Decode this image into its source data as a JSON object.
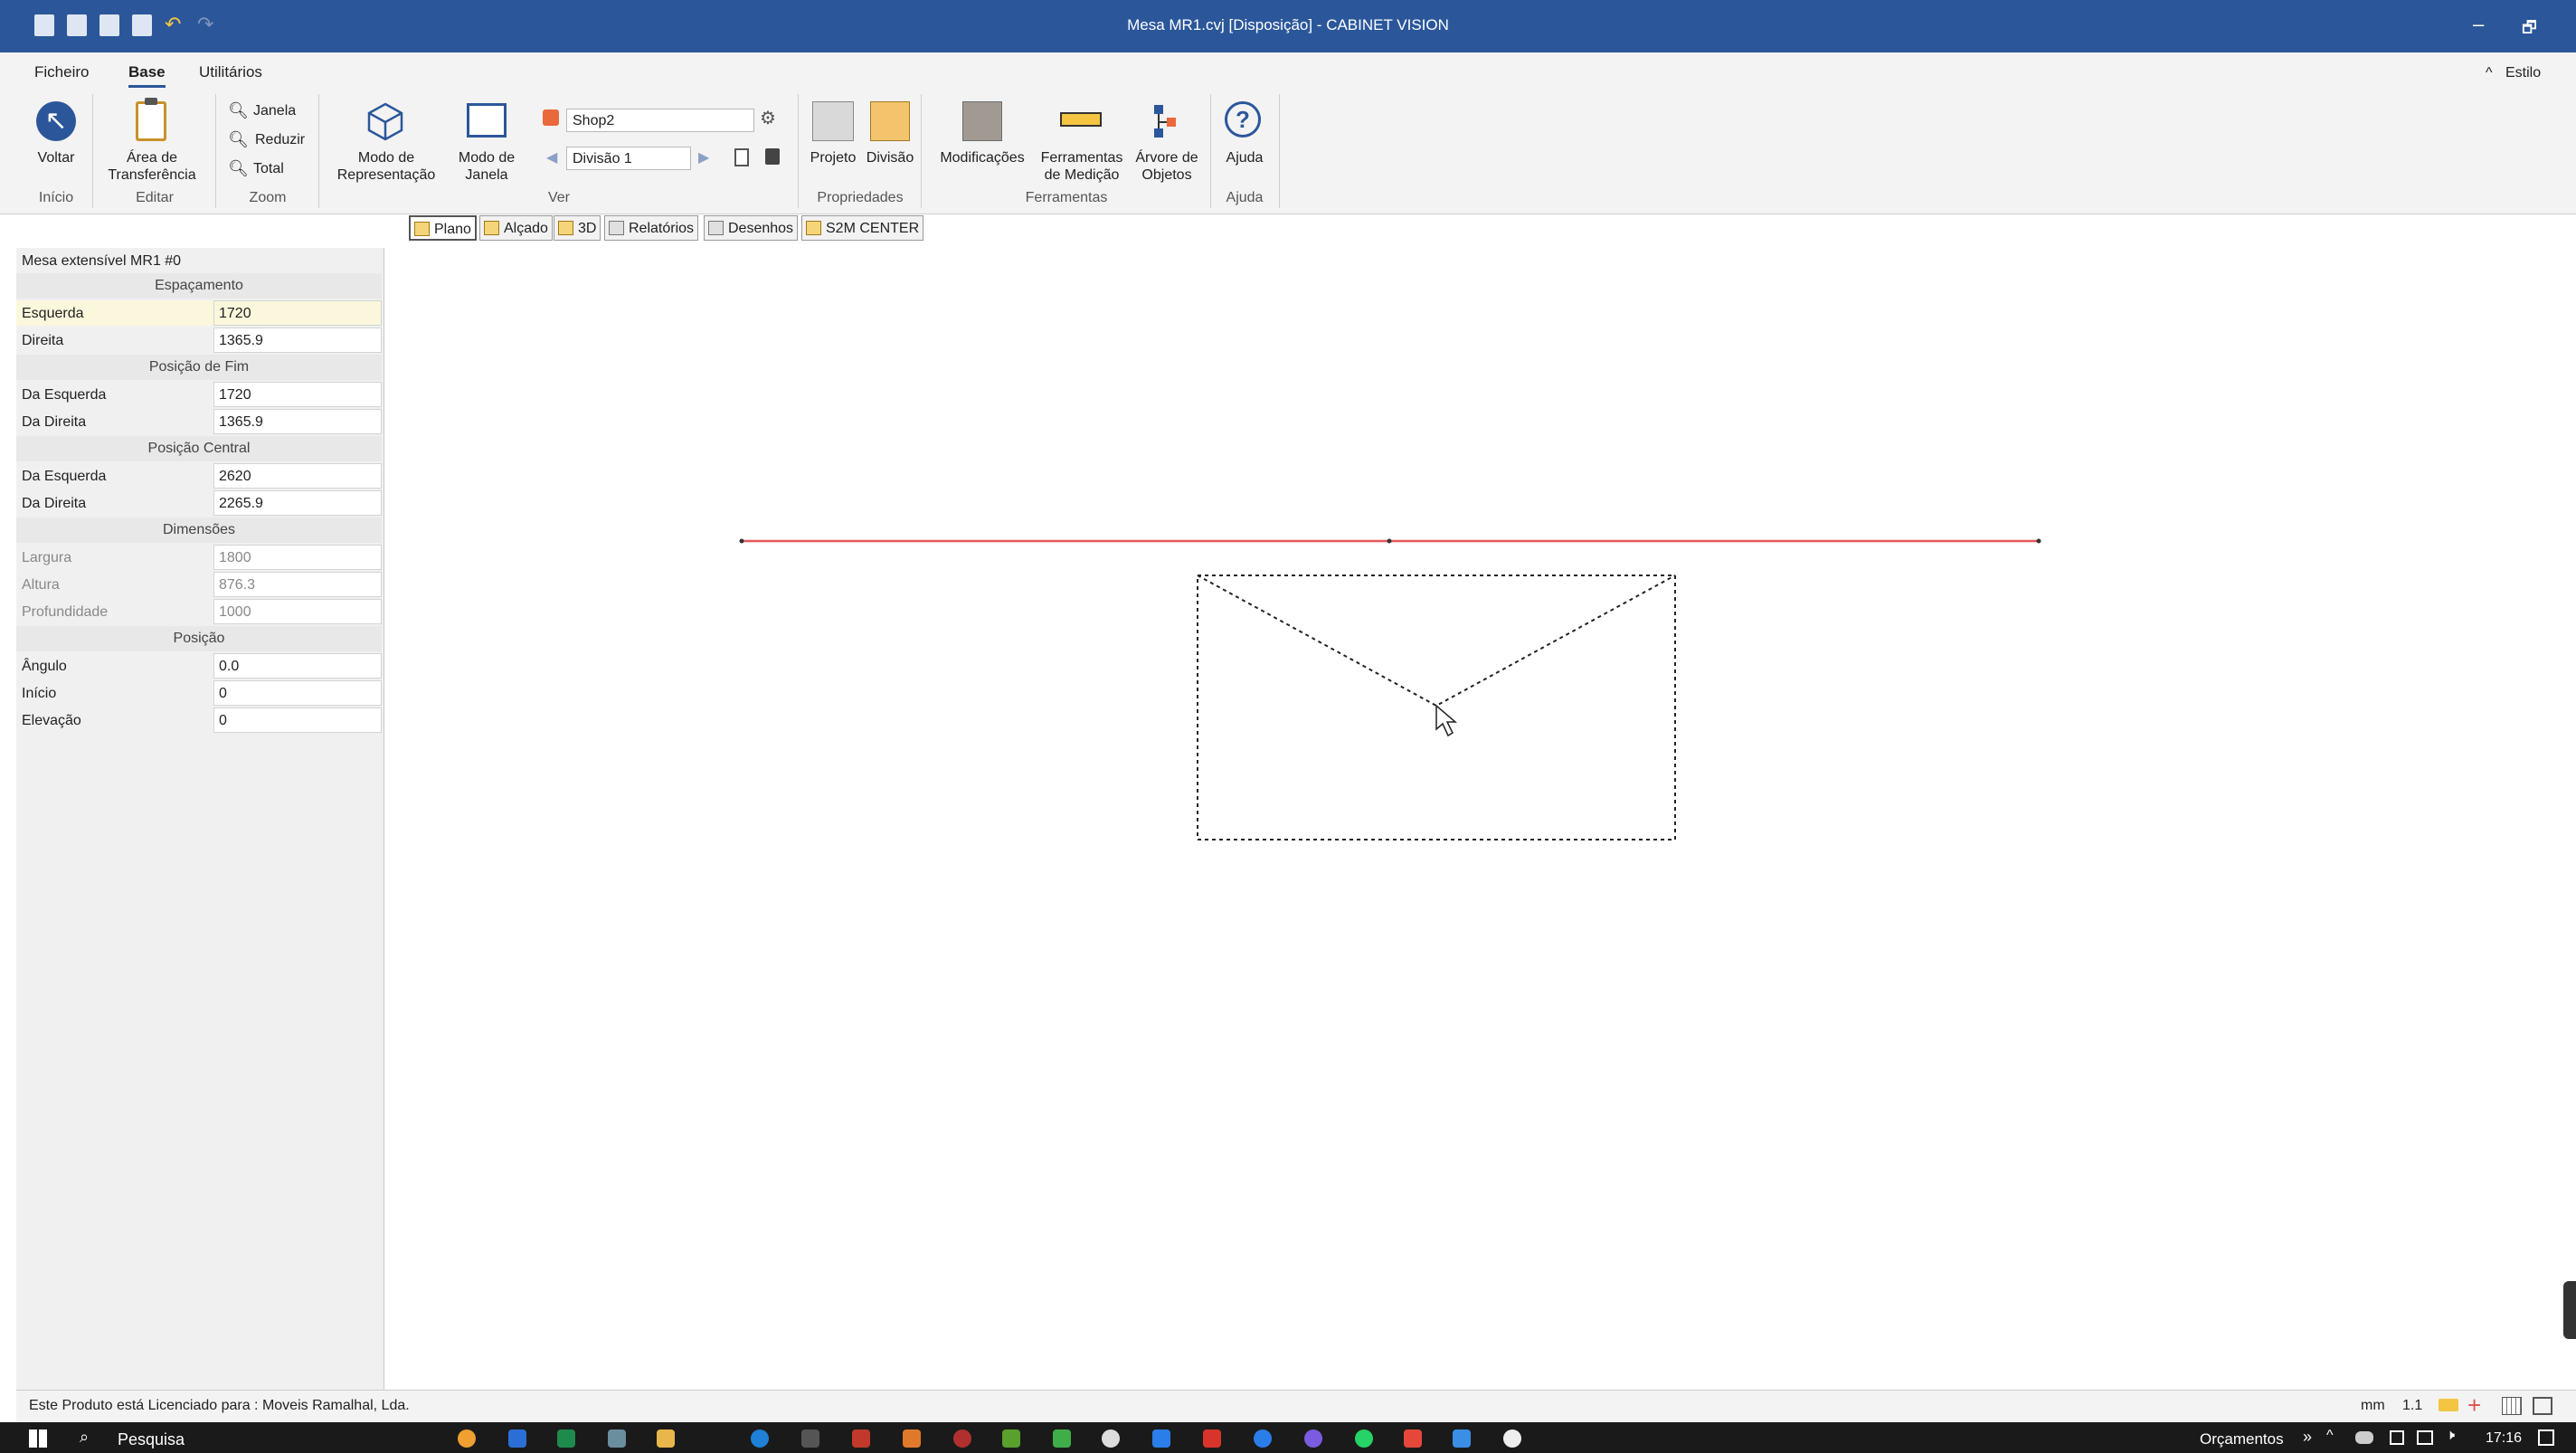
{
  "window": {
    "title": "Mesa MR1.cvj [Disposição] - CABINET VISION",
    "minimize_glyph": "–",
    "restore_glyph": "🗗"
  },
  "menu": {
    "tabs": [
      "Ficheiro",
      "Base",
      "Utilitários"
    ],
    "active": "Base",
    "style_label": "Estilo",
    "collapse_glyph": "^"
  },
  "ribbon": {
    "voltar": "Voltar",
    "area_l1": "Área de",
    "area_l2": "Transferência",
    "janela": "Janela",
    "reduzir": "Reduzir",
    "total": "Total",
    "modo_rep_l1": "Modo de",
    "modo_rep_l2": "Representação",
    "modo_jan_l1": "Modo de",
    "modo_jan_l2": "Janela",
    "shop_value": "Shop2",
    "divisao_value": "Divisão 1",
    "projeto": "Projeto",
    "divisao": "Divisão",
    "modificacoes": "Modificações",
    "ferr_l1": "Ferramentas",
    "ferr_l2": "de Medição",
    "arvore_l1": "Árvore de",
    "arvore_l2": "Objetos",
    "ajuda": "Ajuda",
    "groups": {
      "inicio": "Início",
      "editar": "Editar",
      "zoom": "Zoom",
      "ver": "Ver",
      "propriedades": "Propriedades",
      "ferramentas": "Ferramentas",
      "ajuda": "Ajuda"
    }
  },
  "view_tabs": [
    "Plano",
    "Alçado",
    "3D",
    "Relatórios",
    "Desenhos",
    "S2M CENTER"
  ],
  "panel": {
    "object_name": "Mesa extensível MR1 #0",
    "espacamento": "Espaçamento",
    "esquerda_k": "Esquerda",
    "esquerda_v": "1720",
    "direita_k": "Direita",
    "direita_v": "1365.9",
    "posicao_fim": "Posição de Fim",
    "fim_esq_k": "Da Esquerda",
    "fim_esq_v": "1720",
    "fim_dir_k": "Da Direita",
    "fim_dir_v": "1365.9",
    "posicao_central": "Posição Central",
    "cen_esq_k": "Da Esquerda",
    "cen_esq_v": "2620",
    "cen_dir_k": "Da Direita",
    "cen_dir_v": "2265.9",
    "dimensoes": "Dimensões",
    "largura_k": "Largura",
    "largura_v": "1800",
    "altura_k": "Altura",
    "altura_v": "876.3",
    "prof_k": "Profundidade",
    "prof_v": "1000",
    "posicao": "Posição",
    "angulo_k": "Ângulo",
    "angulo_v": "0.0",
    "inicio_k": "Início",
    "inicio_v": "0",
    "elev_k": "Elevação",
    "elev_v": "0"
  },
  "status": {
    "license": "Este Produto está Licenciado para : Moveis Ramalhal, Lda.",
    "units": "mm",
    "scale": "1.1"
  },
  "taskbar": {
    "search": "Pesquisa",
    "orcamentos": "Orçamentos",
    "chevron": "»",
    "time": "17:16"
  },
  "colors": {
    "accent": "#2b579a",
    "wall_line": "#e8555a"
  }
}
